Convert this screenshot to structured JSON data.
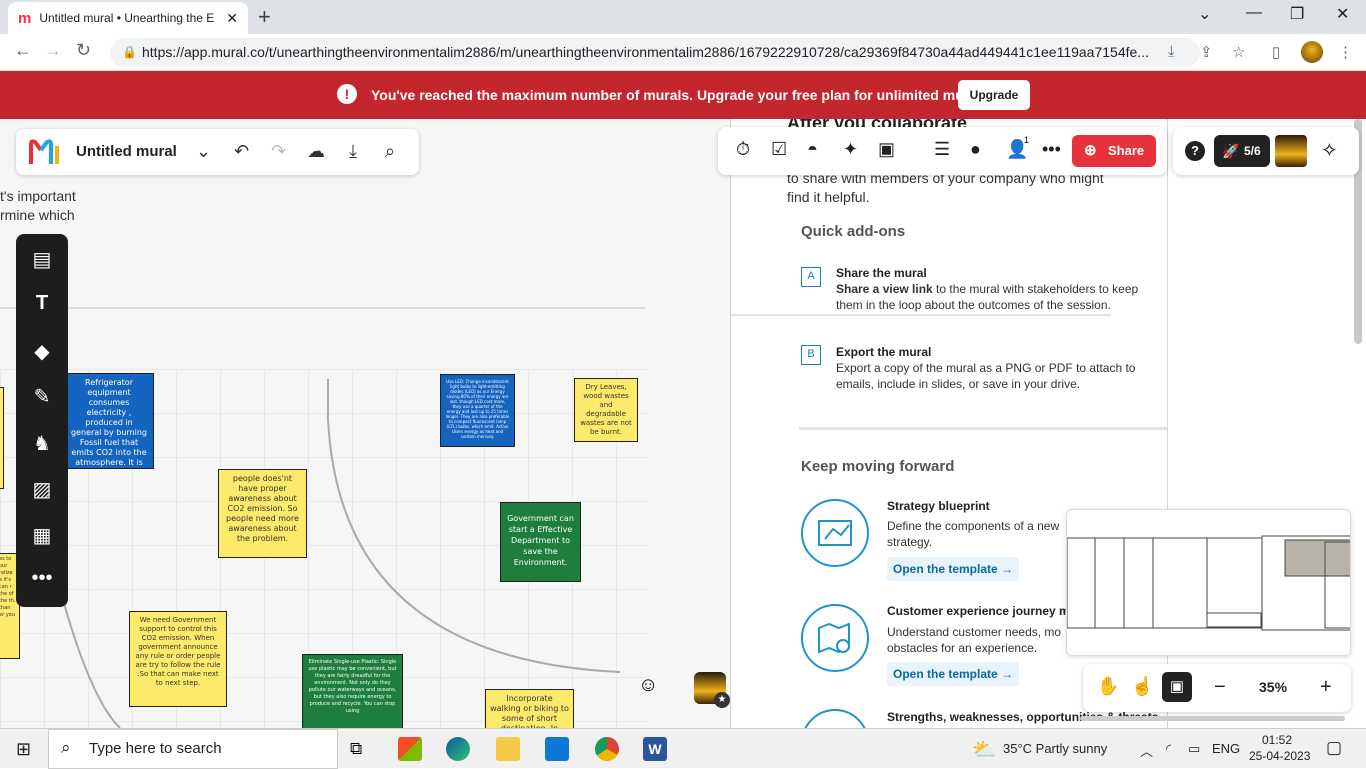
{
  "browser": {
    "tab_title": "Untitled mural • Unearthing the E",
    "url": "https://app.mural.co/t/unearthingtheenvironmentalim2886/m/unearthingtheenvironmentalim2886/1679222910728/ca29369f84730a44ad449441c1ee119aa7154fe..."
  },
  "banner": {
    "message": "You've reached the maximum number of murals. Upgrade your free plan for unlimited murals.",
    "upgrade_label": "Upgrade"
  },
  "mural": {
    "title": "Untitled mural",
    "share_label": "Share",
    "progress": "5/6",
    "notification_count": "1"
  },
  "canvas": {
    "text_line1": "t's important",
    "text_line2": "rmine which",
    "stickies": [
      {
        "text": "Refrigerator equipment consumes electricity , produced in general by burning Fossil fuel that emits CO2 into the atmosphere. It is main contributor to green house gas. So we avoid fridge and AC."
      },
      {
        "text": "people does'nt have proper awareness about CO2 emission. So people need more awareness about the problem."
      },
      {
        "text": "Use LED: Change incandescent light bulbs to light-emitting diodes (LED) as our Energy saving 80% of their energy are lost. though LED cost more, they use a quarter of the energy and last up to 25 times longer. They are also preferable to compact fluorescent lamp (CFL) bulbs, which emit. Active Users energy as heat and contain mercury."
      },
      {
        "text": "Dry Leaves, wood wastes and degradable wastes are not be burnt."
      },
      {
        "text": "Government can start a Effective Department to save the Environment."
      },
      {
        "text": "We need Government support to control this CO2 emission. When government announce any rule or order people are try to follow the rule .So that can make next to next step."
      },
      {
        "text": "Eliminate Single-use Plastic: Single use plastic may be convenient, but they are fairly dreadful for the environment. Not only do they pollute our waterways and oceans, but they also require energy to produce and recycle. You can stop using"
      },
      {
        "text": "Incorporate walking or biking to some of short destination. In"
      },
      {
        "text": "es to our ralize e it's can r the of the th. than er you"
      }
    ]
  },
  "panel": {
    "heading_partial": "After you collaborate",
    "intro": "to share with members of your company who might find it helpful.",
    "quick_addons": "Quick add-ons",
    "addon_a_letter": "A",
    "addon_a_title": "Share the mural",
    "addon_a_bold": "Share a view link",
    "addon_a_text": " to the mural with stakeholders to keep them in the loop about the outcomes of the session.",
    "addon_b_letter": "B",
    "addon_b_title": "Export the mural",
    "addon_b_text": "Export a copy of the mural as a PNG or PDF to attach to emails, include in slides, or save in your drive.",
    "keep_moving": "Keep moving forward",
    "templates": [
      {
        "title": "Strategy blueprint",
        "desc": "Define the components of a new strategy.",
        "link": "Open the template →"
      },
      {
        "title": "Customer experience journey m",
        "desc": "Understand customer needs, mo obstacles for an experience.",
        "link": "Open the template →"
      },
      {
        "title": "Strengths, weaknesses, opportunities & threats",
        "desc": "",
        "link": ""
      }
    ]
  },
  "zoom": {
    "level": "35%"
  },
  "taskbar": {
    "search_placeholder": "Type here to search",
    "weather": "35°C  Partly sunny",
    "lang": "ENG",
    "time": "01:52",
    "date": "25-04-2023"
  }
}
